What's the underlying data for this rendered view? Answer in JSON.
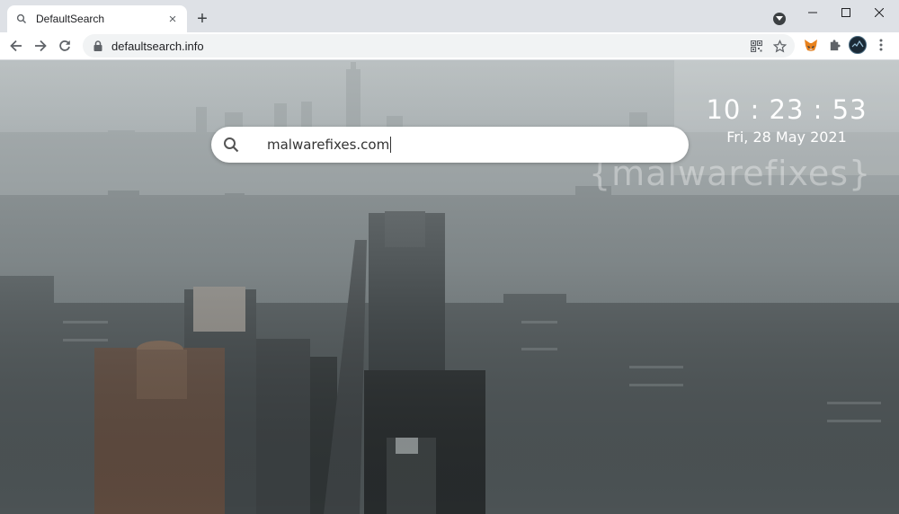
{
  "browser": {
    "tab_title": "DefaultSearch",
    "url": "defaultsearch.info",
    "new_tab_symbol": "+",
    "tab_close_symbol": "×"
  },
  "search": {
    "query": "malwarefixes.com"
  },
  "clock": {
    "time": "10 : 23 : 53",
    "date": "Fri, 28 May 2021"
  },
  "watermark": "{malwarefixes}",
  "icons": [
    "search-icon",
    "close-icon",
    "plus-icon",
    "back-arrow-icon",
    "forward-arrow-icon",
    "reload-icon",
    "lock-icon",
    "qr-code-icon",
    "star-icon",
    "metamask-fox-icon",
    "puzzle-extension-icon",
    "profile-avatar-icon",
    "kebab-menu-icon",
    "minimize-icon",
    "maximize-icon",
    "window-close-icon"
  ]
}
